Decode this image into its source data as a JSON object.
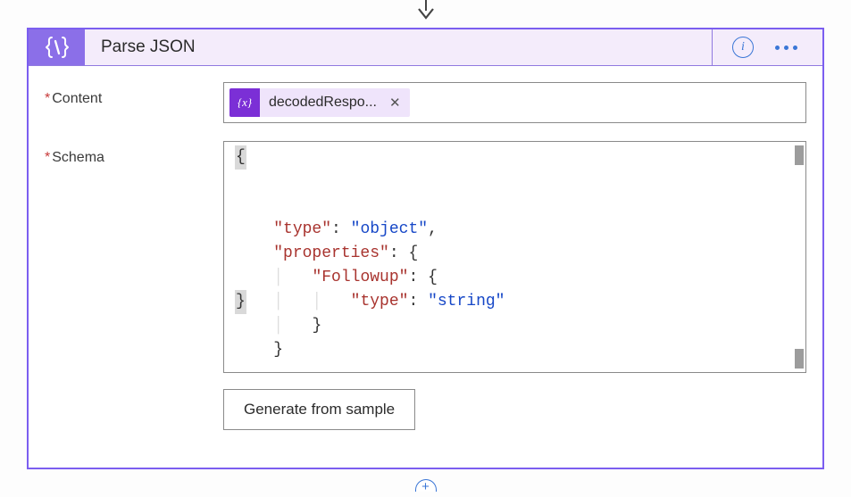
{
  "header": {
    "title": "Parse JSON",
    "info_tooltip": "i"
  },
  "fields": {
    "content": {
      "label": "Content",
      "token_label": "decodedRespo...",
      "token_var_glyph": "{x}"
    },
    "schema": {
      "label": "Schema",
      "code": {
        "l1": "{",
        "l2_k": "\"type\"",
        "l2_s": "\"object\"",
        "l3_k": "\"properties\"",
        "l4_k": "\"Followup\"",
        "l5_k": "\"type\"",
        "l5_s": "\"string\"",
        "l6": "}",
        "l7": "}",
        "l8": "}"
      }
    }
  },
  "buttons": {
    "generate": "Generate from sample"
  }
}
